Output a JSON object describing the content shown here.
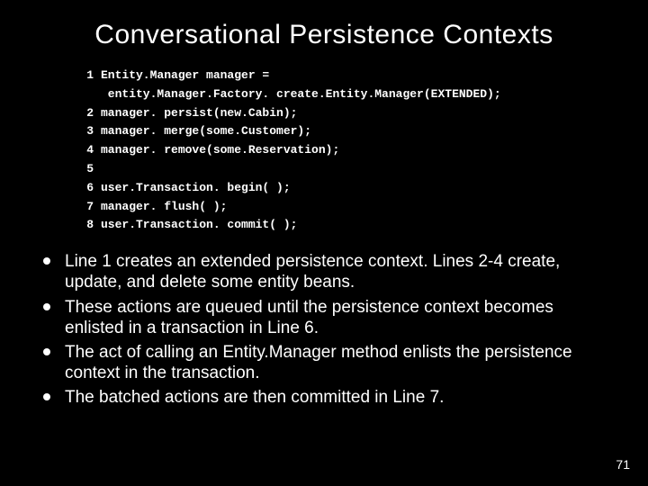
{
  "title": "Conversational Persistence Contexts",
  "code": [
    {
      "n": "1",
      "text": "Entity.Manager manager ="
    },
    {
      "n": "",
      "text": " entity.Manager.Factory. create.Entity.Manager(EXTENDED);"
    },
    {
      "n": "2",
      "text": "manager. persist(new.Cabin);"
    },
    {
      "n": "3",
      "text": "manager. merge(some.Customer);"
    },
    {
      "n": "4",
      "text": "manager. remove(some.Reservation);"
    },
    {
      "n": "5",
      "text": ""
    },
    {
      "n": "6",
      "text": "user.Transaction. begin( );"
    },
    {
      "n": "7",
      "text": "manager. flush( );"
    },
    {
      "n": "8",
      "text": "user.Transaction. commit( );"
    }
  ],
  "bullets": [
    "Line 1 creates an extended persistence context. Lines 2-4 create, update, and delete some entity beans.",
    "These actions are queued until the persistence context becomes enlisted in a transaction in Line 6.",
    "The act of calling an Entity.Manager method enlists the persistence context in the transaction.",
    "The batched actions are then committed in Line 7."
  ],
  "pageNumber": "71"
}
